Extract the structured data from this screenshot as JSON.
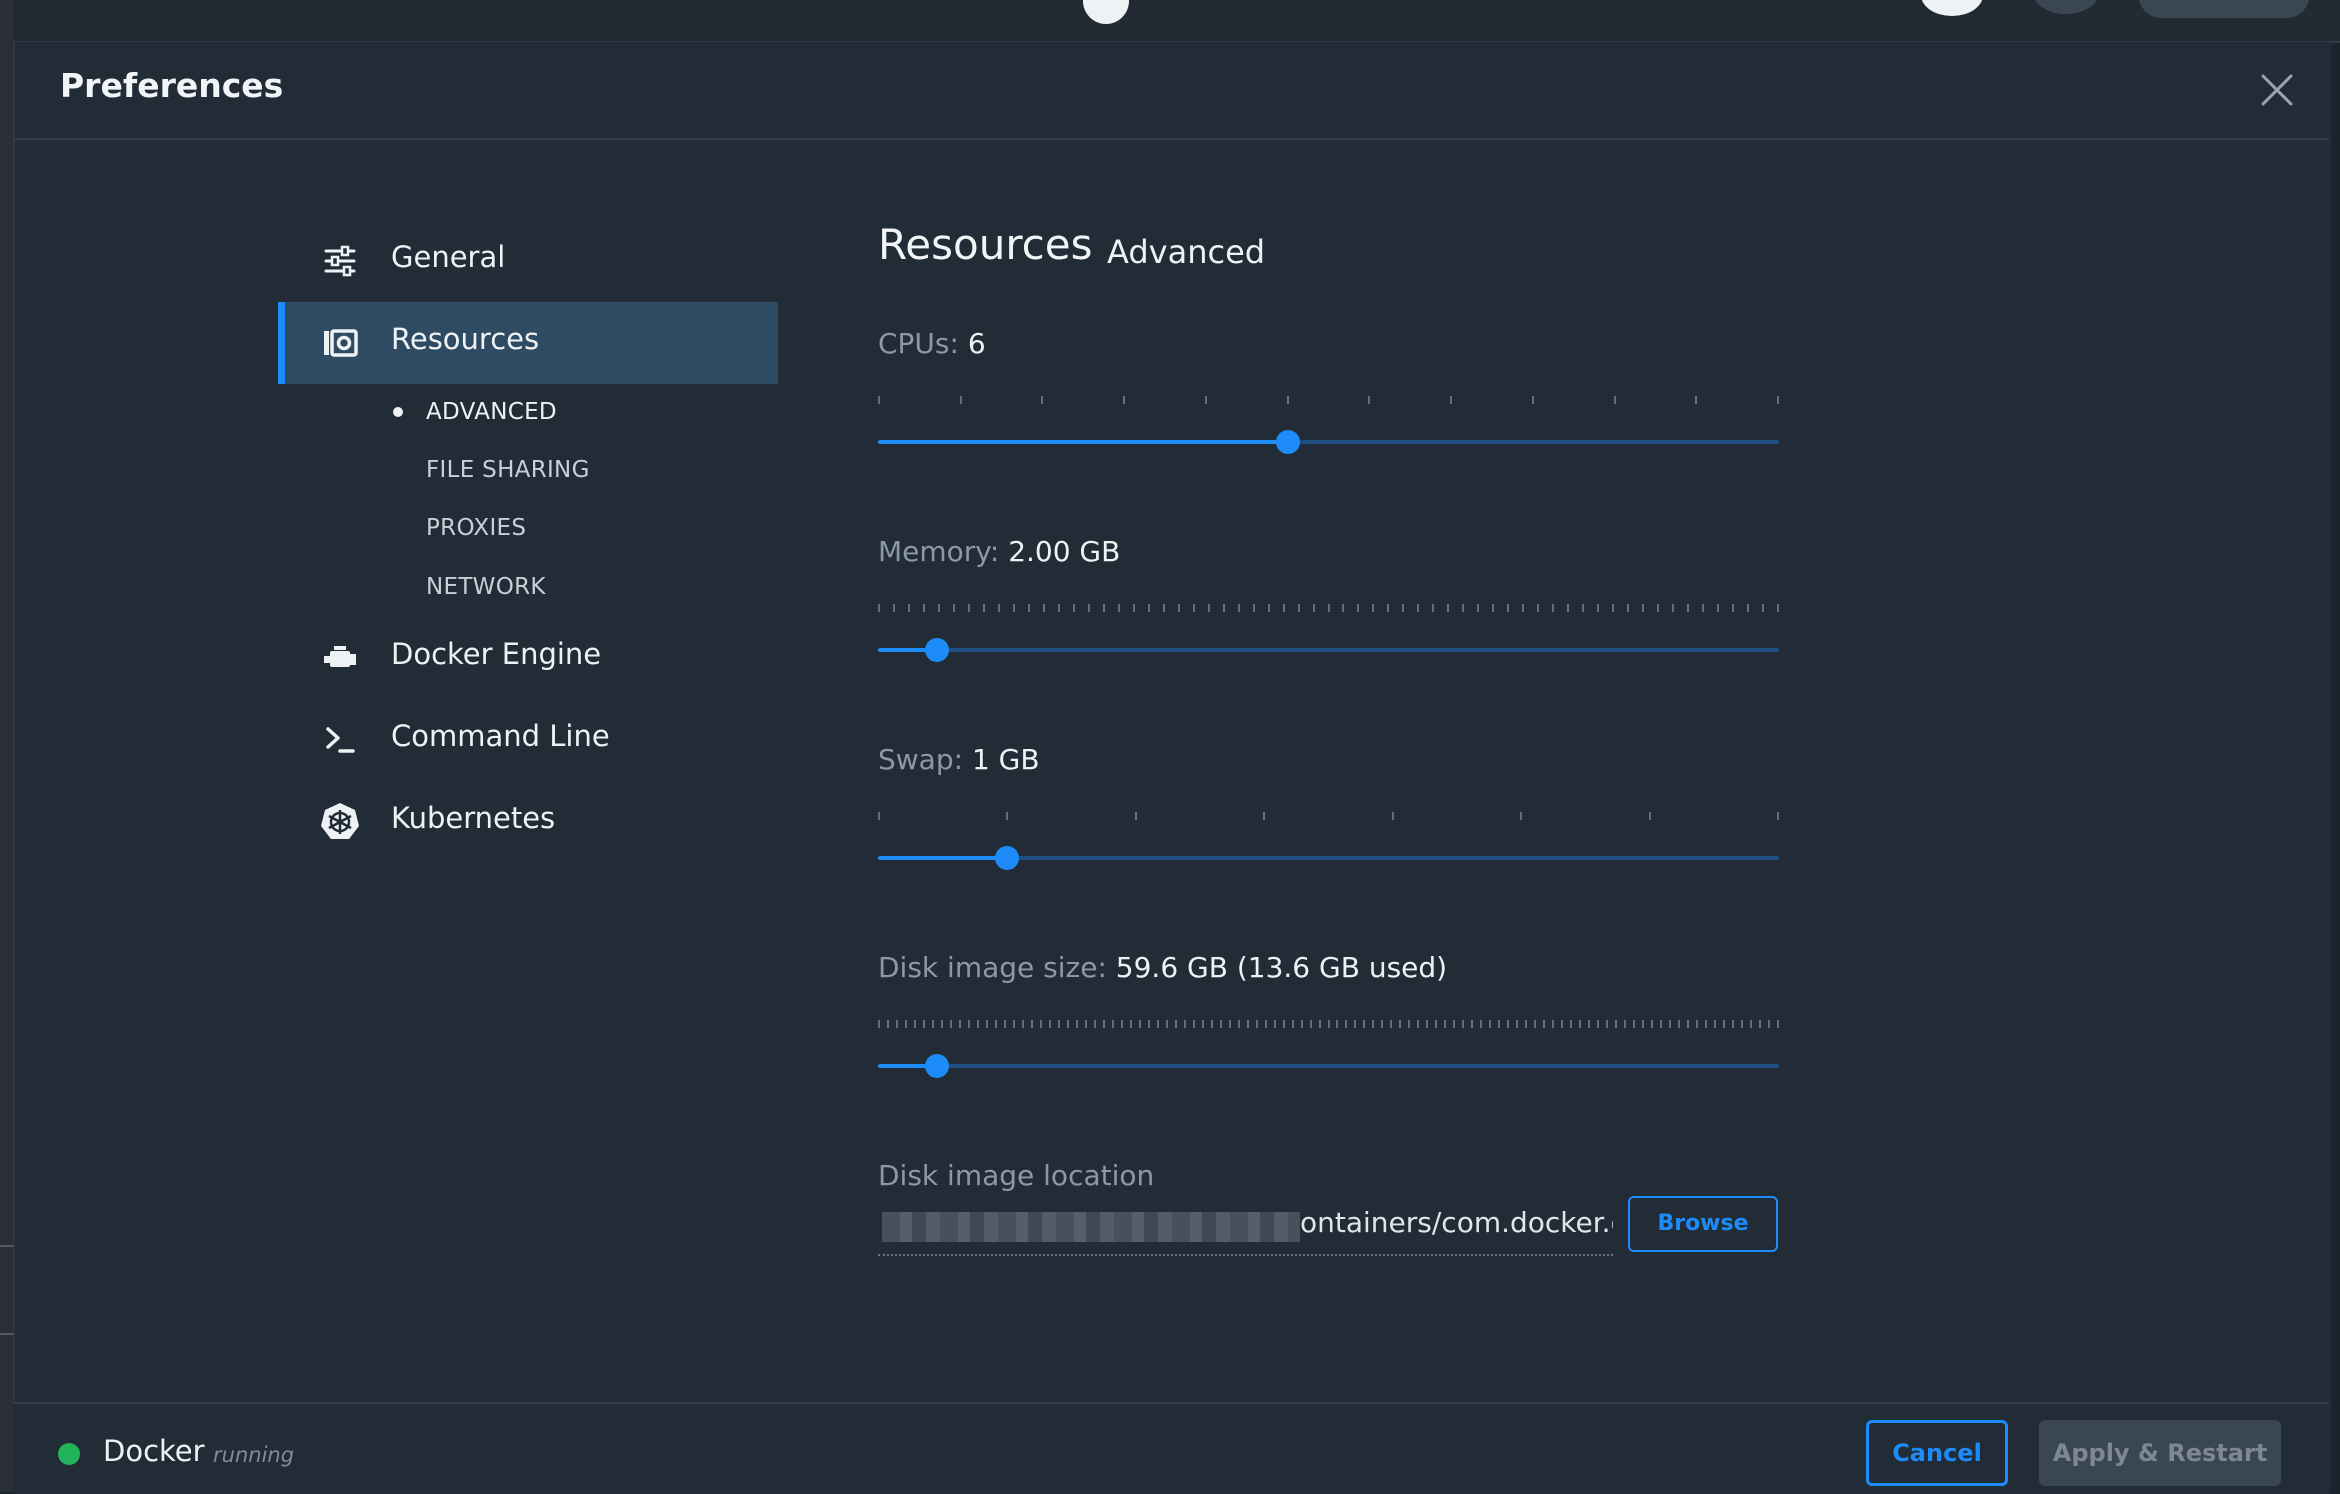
{
  "window": {
    "title": "Preferences"
  },
  "sidebar": {
    "items": [
      {
        "label": "General",
        "icon": "sliders-icon"
      },
      {
        "label": "Resources",
        "icon": "resources-icon",
        "active": true
      },
      {
        "label": "Docker Engine",
        "icon": "engine-icon"
      },
      {
        "label": "Command Line",
        "icon": "terminal-icon"
      },
      {
        "label": "Kubernetes",
        "icon": "kubernetes-icon"
      }
    ],
    "subitems": [
      {
        "label": "ADVANCED",
        "current": true
      },
      {
        "label": "FILE SHARING"
      },
      {
        "label": "PROXIES"
      },
      {
        "label": "NETWORK"
      }
    ]
  },
  "content": {
    "title": "Resources",
    "subtitle": "Advanced",
    "cpus": {
      "label": "CPUs:",
      "value": "6",
      "fraction": 0.4545
    },
    "memory": {
      "label": "Memory:",
      "value": "2.00 GB",
      "fraction": 0.066
    },
    "swap": {
      "label": "Swap:",
      "value": "1 GB",
      "fraction": 0.143
    },
    "disk_size": {
      "label": "Disk image size:",
      "value": "59.6 GB (13.6 GB used)",
      "fraction": 0.066
    },
    "disk_location": {
      "label": "Disk image location",
      "value": "ontainers/com.docker.dc",
      "browse_label": "Browse"
    }
  },
  "footer": {
    "app_name": "Docker",
    "status": "running",
    "status_color": "#22b35b",
    "cancel_label": "Cancel",
    "apply_label": "Apply & Restart"
  },
  "colors": {
    "accent": "#1d8cf8",
    "background": "#212c36",
    "sidebar_active": "#2e4b63"
  }
}
